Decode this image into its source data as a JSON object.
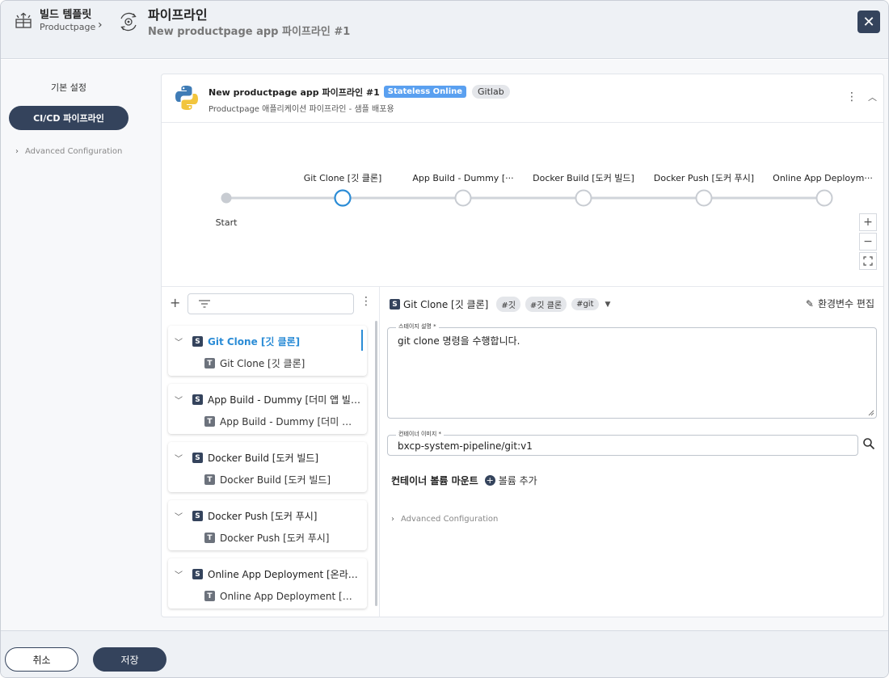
{
  "header": {
    "crumb1_title": "빌드 템플릿",
    "crumb1_sub": "Productpage",
    "crumb2_title": "파이프라인",
    "crumb2_sub": "New productpage app 파이프라인 #1",
    "close_label": "✕"
  },
  "leftnav": {
    "basic": "기본 설정",
    "cicd": "CI/CD 파이프라인",
    "advanced": "Advanced Configuration"
  },
  "card": {
    "name": "New productpage app 파이프라인 #1",
    "badge_online": "Stateless Online",
    "badge_git": "Gitlab",
    "subtitle": "Productpage 애플리케이션 파이프라인 - 샘플 배포용"
  },
  "graph": {
    "start_label": "Start",
    "nodes": [
      {
        "label": "Git Clone [깃 클론]"
      },
      {
        "label": "App Build - Dummy [···"
      },
      {
        "label": "Docker Build [도커 빌드]"
      },
      {
        "label": "Docker Push [도커 푸시]"
      },
      {
        "label": "Online App Deploym···"
      }
    ],
    "zoom_in": "+",
    "zoom_out": "−"
  },
  "stages": [
    {
      "name": "Git Clone [깃 클론]",
      "task": "Git Clone [깃 클론]"
    },
    {
      "name": "App Build - Dummy [더미 앱 빌드]",
      "task": "App Build - Dummy [더미 앱 빌드]"
    },
    {
      "name": "Docker Build [도커 빌드]",
      "task": "Docker Build [도커 빌드]"
    },
    {
      "name": "Docker Push [도커 푸시]",
      "task": "Docker Push [도커 푸시]"
    },
    {
      "name": "Online App Deployment [온라인 앱 배포]",
      "task": "Online App Deployment [온라인 앱 배포]"
    }
  ],
  "detail": {
    "stage_name": "Git Clone [깃 클론]",
    "tags": [
      "#깃",
      "#깃 클론",
      "#git"
    ],
    "env_edit": "환경변수 편집",
    "desc_label": "스테이지 설명 *",
    "desc_value": "git clone 명령을 수행합니다.",
    "image_label": "컨테이너 이미지 *",
    "image_value": "bxcp-system-pipeline/git:v1",
    "volume_label": "컨테이너 볼륨 마운트",
    "volume_add": "볼륨 추가",
    "advanced": "Advanced Configuration"
  },
  "footer": {
    "cancel": "취소",
    "save": "저장"
  },
  "colors": {
    "navy": "#34435c",
    "accent": "#2b8cd6",
    "badge_online": "#5aa0f0"
  }
}
